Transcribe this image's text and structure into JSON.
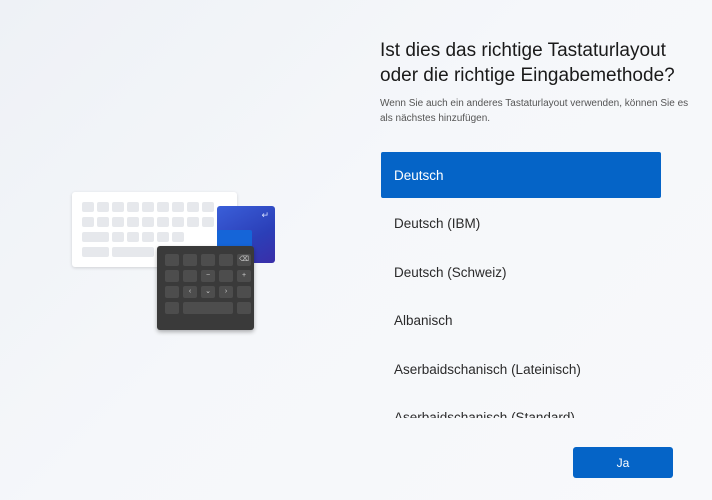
{
  "heading": {
    "title": "Ist dies das richtige Tastaturlayout oder die richtige Eingabemethode?",
    "subtitle": "Wenn Sie auch ein anderes Tastaturlayout verwenden, können Sie es als nächstes hinzufügen."
  },
  "layouts": [
    {
      "label": "Deutsch",
      "selected": true
    },
    {
      "label": "Deutsch (IBM)",
      "selected": false
    },
    {
      "label": "Deutsch (Schweiz)",
      "selected": false
    },
    {
      "label": "Albanisch",
      "selected": false
    },
    {
      "label": "Aserbaidschanisch (Lateinisch)",
      "selected": false
    },
    {
      "label": "Aserbaidschanisch (Standard)",
      "selected": false
    }
  ],
  "actions": {
    "confirm_label": "Ja"
  },
  "illustration": {
    "icon": "keyboard-illustration",
    "accent": "#0564c7"
  }
}
